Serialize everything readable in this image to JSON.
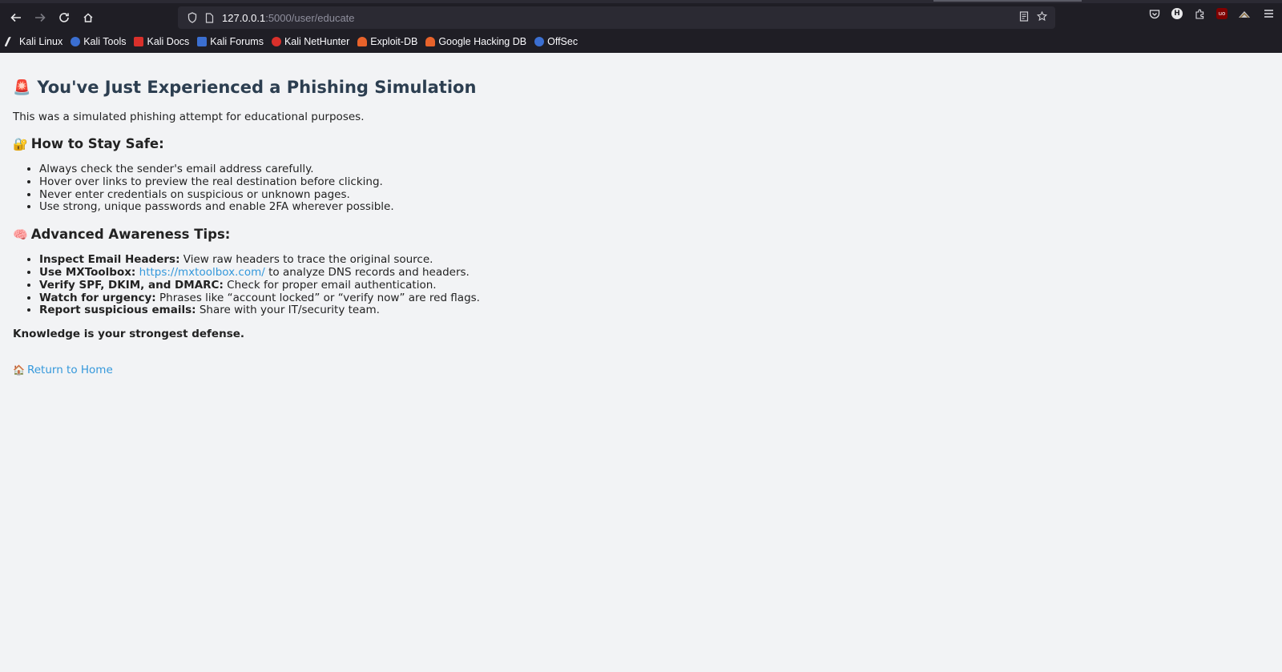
{
  "browser": {
    "url_host": "127.0.0.1",
    "url_path": ":5000/user/educate",
    "bookmarks": [
      {
        "label": "Kali Linux",
        "color": "#1f1e25"
      },
      {
        "label": "Kali Tools",
        "color": "#3b6fd1"
      },
      {
        "label": "Kali Docs",
        "color": "#d9302b"
      },
      {
        "label": "Kali Forums",
        "color": "#3b6fd1"
      },
      {
        "label": "Kali NetHunter",
        "color": "#d9302b"
      },
      {
        "label": "Exploit-DB",
        "color": "#e8632b"
      },
      {
        "label": "Google Hacking DB",
        "color": "#e8632b"
      },
      {
        "label": "OffSec",
        "color": "#3b6fd1"
      }
    ]
  },
  "page": {
    "title_emoji": "🚨",
    "title": "You've Just Experienced a Phishing Simulation",
    "intro": "This was a simulated phishing attempt for educational purposes.",
    "safe_emoji": "🔐",
    "safe_heading": "How to Stay Safe:",
    "safe_items": [
      "Always check the sender's email address carefully.",
      "Hover over links to preview the real destination before clicking.",
      "Never enter credentials on suspicious or unknown pages.",
      "Use strong, unique passwords and enable 2FA wherever possible."
    ],
    "adv_emoji": "🧠",
    "adv_heading": "Advanced Awareness Tips:",
    "tips": [
      {
        "title": "Inspect Email Headers:",
        "text": " View raw headers to trace the original source."
      },
      {
        "title": "Use MXToolbox:",
        "link": "https://mxtoolbox.com/",
        "text": " to analyze DNS records and headers."
      },
      {
        "title": "Verify SPF, DKIM, and DMARC:",
        "text": " Check for proper email authentication."
      },
      {
        "title": "Watch for urgency:",
        "text": " Phrases like “account locked” or “verify now” are red flags."
      },
      {
        "title": "Report suspicious emails:",
        "text": " Share with your IT/security team."
      }
    ],
    "closing": "Knowledge is your strongest defense.",
    "home_emoji": "🏠",
    "home_link": "Return to Home"
  }
}
